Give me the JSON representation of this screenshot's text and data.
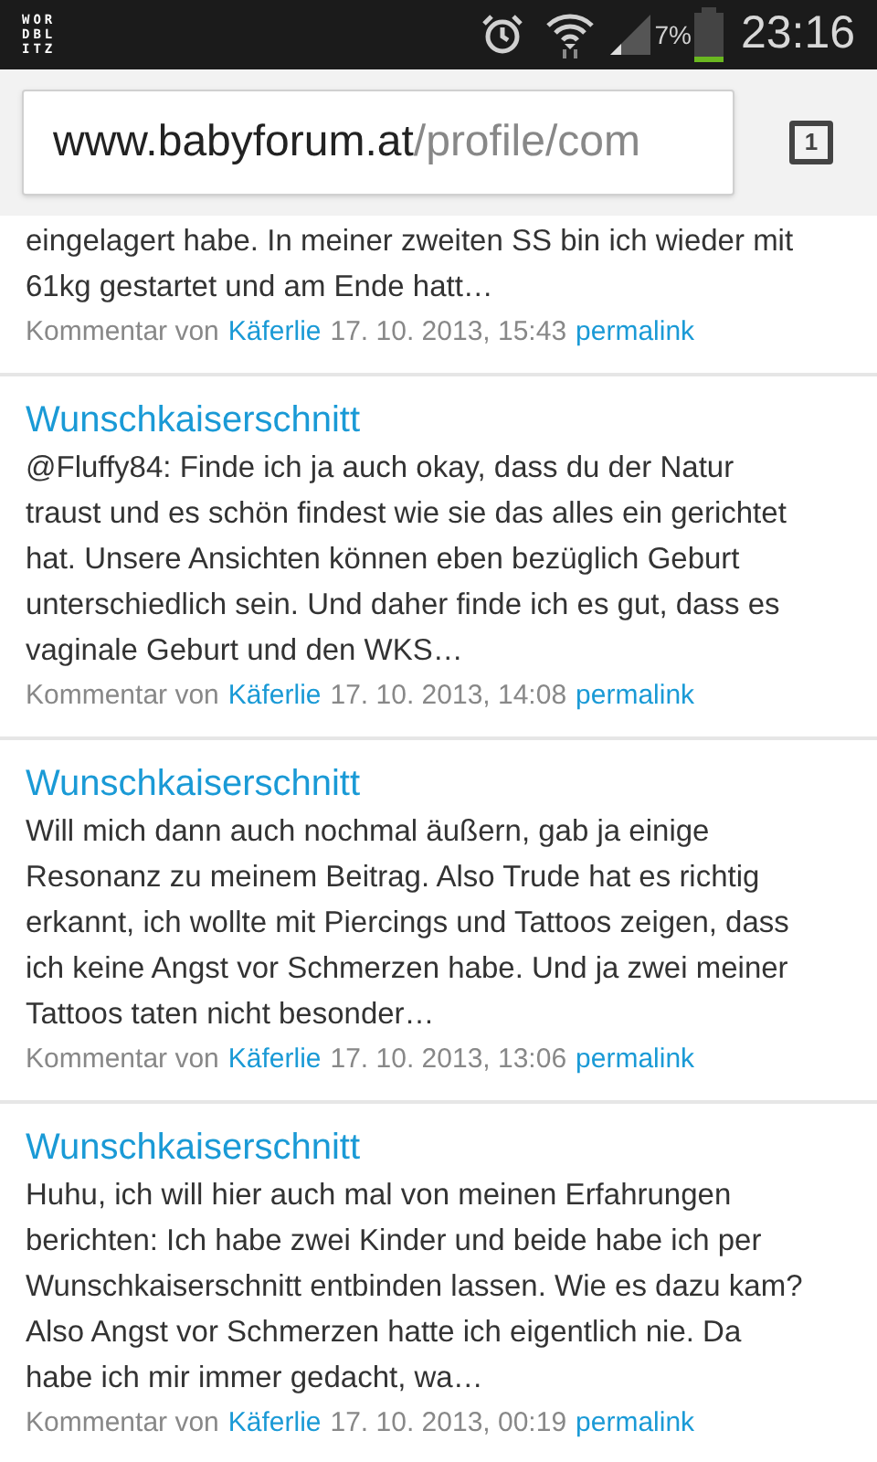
{
  "status_bar": {
    "app_icon": [
      "WOR",
      "DBL",
      "ITZ"
    ],
    "battery_text": "7%",
    "time": "23:16"
  },
  "address_bar": {
    "domain": "www.babyforum.at",
    "path": "/profile/com",
    "tab_count": "1"
  },
  "comments": [
    {
      "lines": [
        "eingelagert habe. In meiner zweiten SS bin ich wieder mit",
        "61kg gestartet und am Ende hatt…"
      ],
      "meta_prefix": "Kommentar von",
      "author": "Käferlie",
      "date": "17. 10. 2013, 15:43",
      "link": "permalink"
    },
    {
      "title": "Wunschkaiserschnitt",
      "lines": [
        "@Fluffy84: Finde ich ja auch okay, dass du der Natur",
        "traust und es schön findest wie sie das alles ein gerichtet",
        "hat. Unsere Ansichten können eben bezüglich Geburt",
        "unterschiedlich sein. Und daher finde ich es gut, dass es",
        "vaginale Geburt und den WKS…"
      ],
      "meta_prefix": "Kommentar von",
      "author": "Käferlie",
      "date": "17. 10. 2013, 14:08",
      "link": "permalink"
    },
    {
      "title": "Wunschkaiserschnitt",
      "lines": [
        "Will mich dann auch nochmal äußern, gab ja einige",
        "Resonanz zu meinem Beitrag. Also Trude hat es richtig",
        "erkannt, ich wollte mit Piercings und Tattoos zeigen, dass",
        "ich keine Angst vor Schmerzen habe. Und ja zwei meiner",
        "Tattoos taten nicht besonder…"
      ],
      "meta_prefix": "Kommentar von",
      "author": "Käferlie",
      "date": "17. 10. 2013, 13:06",
      "link": "permalink"
    },
    {
      "title": "Wunschkaiserschnitt",
      "lines": [
        "Huhu, ich will hier auch mal von meinen Erfahrungen",
        "berichten: Ich habe zwei Kinder und beide habe ich per",
        "Wunschkaiserschnitt entbinden lassen. Wie es dazu kam?",
        "Also Angst vor Schmerzen hatte ich eigentlich nie. Da",
        "habe ich mir immer gedacht, wa…"
      ],
      "meta_prefix": "Kommentar von",
      "author": "Käferlie",
      "date": "17. 10. 2013, 00:19",
      "link": "permalink"
    }
  ]
}
